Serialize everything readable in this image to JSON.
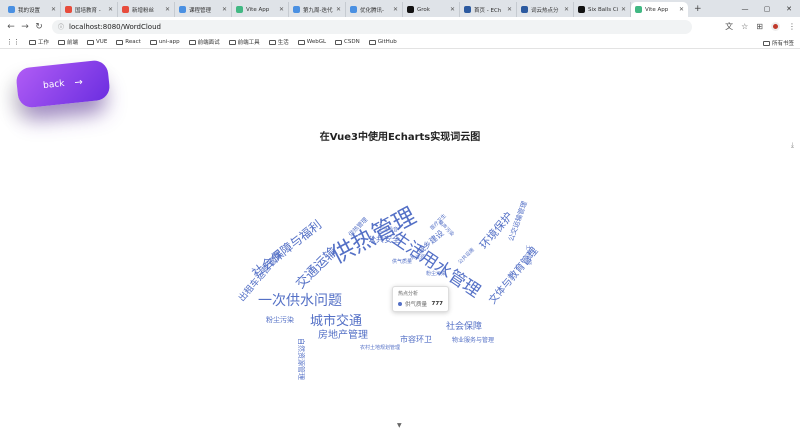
{
  "browser": {
    "tabs": [
      {
        "label": "我的设置",
        "color": "#4a90e2"
      },
      {
        "label": "国培教育 -",
        "color": "#e74c3c"
      },
      {
        "label": "新增粉丝",
        "color": "#e74c3c"
      },
      {
        "label": "课程管理",
        "color": "#4a90e2"
      },
      {
        "label": "Vite App",
        "color": "#41b883"
      },
      {
        "label": "第九周-迭代",
        "color": "#4a90e2"
      },
      {
        "label": "优化腾讯-",
        "color": "#4a90e2"
      },
      {
        "label": "Grok",
        "color": "#111111"
      },
      {
        "label": "首页 - ECh",
        "color": "#2c5aa0"
      },
      {
        "label": "词云热点分",
        "color": "#2c5aa0"
      },
      {
        "label": "Six Balls Ci",
        "color": "#111111"
      },
      {
        "label": "Vite App",
        "color": "#41b883",
        "active": true
      }
    ],
    "new_tab": "+",
    "url": "localhost:8080/WordCloud",
    "bookmarks": [
      "工作",
      "前端",
      "VUE",
      "React",
      "uni-app",
      "前端面试",
      "前端工具",
      "生活",
      "WebGL",
      "CSDN",
      "GitHub"
    ],
    "all_bookmarks": "所有书签"
  },
  "page": {
    "back_label": "back",
    "title": "在Vue3中使用Echarts实现词云图"
  },
  "tooltip": {
    "title": "热点分析",
    "name": "供气质量",
    "value": "777"
  },
  "chart_data": {
    "type": "wordcloud",
    "series_color": "#5470c6",
    "words": [
      {
        "text": "供热管理",
        "size": 23,
        "rot": -28
      },
      {
        "text": "生活用水管理",
        "size": 17,
        "rot": 34
      },
      {
        "text": "城市交通",
        "size": 13,
        "rot": 0
      },
      {
        "text": "一次供水问题",
        "size": 14,
        "rot": 0
      },
      {
        "text": "交通运输",
        "size": 13,
        "rot": -45
      },
      {
        "text": "社会保障与福利",
        "size": 12,
        "rot": -38
      },
      {
        "text": "出租车运营管理",
        "size": 9,
        "rot": -50
      },
      {
        "text": "环境保护",
        "size": 11,
        "rot": -50
      },
      {
        "text": "文体与教育管理",
        "size": 10,
        "rot": -50
      },
      {
        "text": "房地产管理",
        "size": 10,
        "rot": 0
      },
      {
        "text": "社会保障",
        "size": 9,
        "rot": 0
      },
      {
        "text": "公共安全",
        "size": 8,
        "rot": 0
      },
      {
        "text": "城乡建设",
        "size": 8,
        "rot": -40
      },
      {
        "text": "市容环卫",
        "size": 8,
        "rot": 0
      },
      {
        "text": "自然资源管理",
        "size": 7,
        "rot": 90
      },
      {
        "text": "公交运输管理",
        "size": 7,
        "rot": -70
      },
      {
        "text": "粉尘污染",
        "size": 7,
        "rot": 0
      },
      {
        "text": "物业服务与管理",
        "size": 6,
        "rot": 0
      },
      {
        "text": "农村土地规划管理",
        "size": 5,
        "rot": 0
      },
      {
        "text": "供热管理",
        "size": 6,
        "rot": -45
      },
      {
        "text": "生活噪音",
        "size": 5,
        "rot": 0
      },
      {
        "text": "医疗卫生",
        "size": 5,
        "rot": -45
      },
      {
        "text": "噪声污染",
        "size": 5,
        "rot": 45
      },
      {
        "text": "土地资源",
        "size": 5,
        "rot": 90
      },
      {
        "text": "公共设施",
        "size": 5,
        "rot": -45
      },
      {
        "text": "水资源",
        "size": 5,
        "rot": 0
      },
      {
        "text": "粉尘污染",
        "size": 5,
        "rot": 0
      },
      {
        "text": "供气质量",
        "size": 5,
        "rot": 0
      }
    ]
  }
}
